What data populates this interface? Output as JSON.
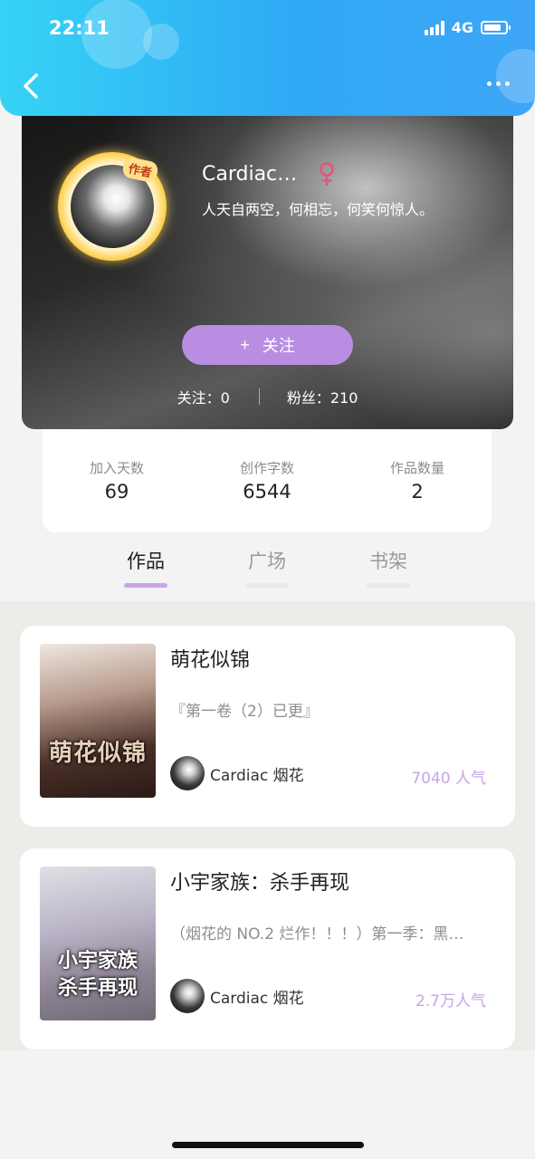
{
  "status_bar": {
    "time": "22:11",
    "network": "4G",
    "battery_level": 0.7
  },
  "header": {
    "back_icon": "chevron-left-icon",
    "more_icon": "more-horizontal-icon"
  },
  "profile": {
    "avatar_badge": "作者",
    "username": "Cardiac…",
    "gender_icon": "female-icon",
    "gender_color": "#e0587a",
    "bio": "人天自两空，何相忘，何笑何惊人。",
    "follow_button": {
      "icon": "+",
      "label": "关注"
    },
    "following_label": "关注：",
    "following_count": "0",
    "fans_label": "粉丝：",
    "fans_count": "210"
  },
  "counts": [
    {
      "label": "加入天数",
      "value": "69"
    },
    {
      "label": "创作字数",
      "value": "6544"
    },
    {
      "label": "作品数量",
      "value": "2"
    }
  ],
  "tabs": [
    {
      "label": "作品",
      "active": true
    },
    {
      "label": "广场",
      "active": false
    },
    {
      "label": "书架",
      "active": false
    }
  ],
  "works": [
    {
      "title": "萌花似锦",
      "description": "『第一卷（2）已更』",
      "cover_text": "萌花似锦",
      "author": "Cardiac 烟花",
      "popularity": "7040 人气"
    },
    {
      "title": "小宇家族：杀手再现",
      "description": "（烟花的 NO.2 烂作！！！）第一季：黑…",
      "cover_text": "小宇家族\n杀手再现",
      "author": "Cardiac 烟花",
      "popularity": "2.7万人气"
    }
  ],
  "colors": {
    "header_gradient_start": "#36d3f5",
    "header_gradient_end": "#3ea5f7",
    "accent_purple": "#b98ee2",
    "popularity_color": "#c6a4ea"
  }
}
